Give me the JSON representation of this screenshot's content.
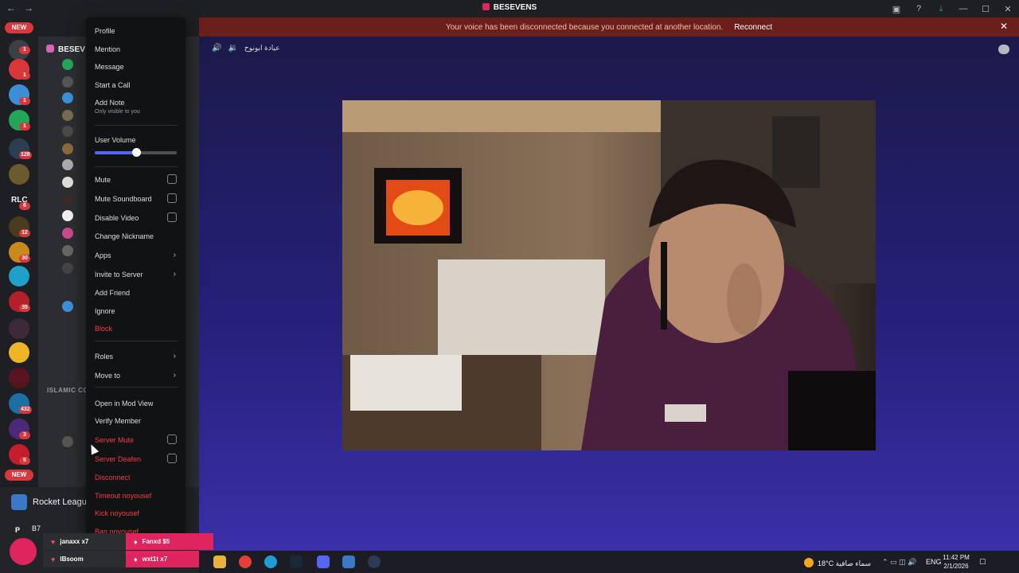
{
  "titlebar": {
    "app_title": "BESEVENS"
  },
  "banner": {
    "text": "Your voice has been disconnected because you connected at another location.",
    "reconnect": "Reconnect"
  },
  "server_rail": {
    "new_top": "NEW",
    "new_bottom": "NEW",
    "rlc": "RLC",
    "badges": [
      "1",
      "1",
      "1",
      "1",
      "128",
      "6",
      "12",
      "30",
      "35",
      "432",
      "3",
      "5"
    ]
  },
  "channels": {
    "server_name": "BESEV",
    "category": "ISLAMIC CO",
    "activity": "Rocket League",
    "user_initial": "P",
    "user_name": "B7"
  },
  "stage": {
    "title": "عيادة ابونوح"
  },
  "context_menu": {
    "profile": "Profile",
    "mention": "Mention",
    "message": "Message",
    "start_call": "Start a Call",
    "add_note": "Add Note",
    "add_note_sub": "Only visible to you",
    "user_volume": "User Volume",
    "volume": 0.5,
    "mute": "Mute",
    "mute_soundboard": "Mute Soundboard",
    "disable_video": "Disable Video",
    "change_nickname": "Change Nickname",
    "apps": "Apps",
    "invite_to_server": "Invite to Server",
    "add_friend": "Add Friend",
    "ignore": "Ignore",
    "block": "Block",
    "roles": "Roles",
    "move_to": "Move to",
    "open_in_mod_view": "Open in Mod View",
    "verify_member": "Verify Member",
    "server_mute": "Server Mute",
    "server_deafen": "Server Deafen",
    "disconnect": "Disconnect",
    "timeout": "Timeout noyousef",
    "kick": "Kick noyousef",
    "ban": "Ban noyousef"
  },
  "overlay": {
    "items": [
      {
        "name": "janaxx x7"
      },
      {
        "name": "IBsoom"
      },
      {
        "name": "Fanxd $5"
      },
      {
        "name": "wxt1t x7"
      }
    ]
  },
  "taskbar": {
    "temp": "18°C",
    "weather": "سماء صافية",
    "lang": "ENG",
    "time": "11:42 PM",
    "date": "2/1/2026"
  },
  "colors": {
    "accent": "#5865f2",
    "danger": "#f23f43",
    "brand": "#e0245e"
  }
}
